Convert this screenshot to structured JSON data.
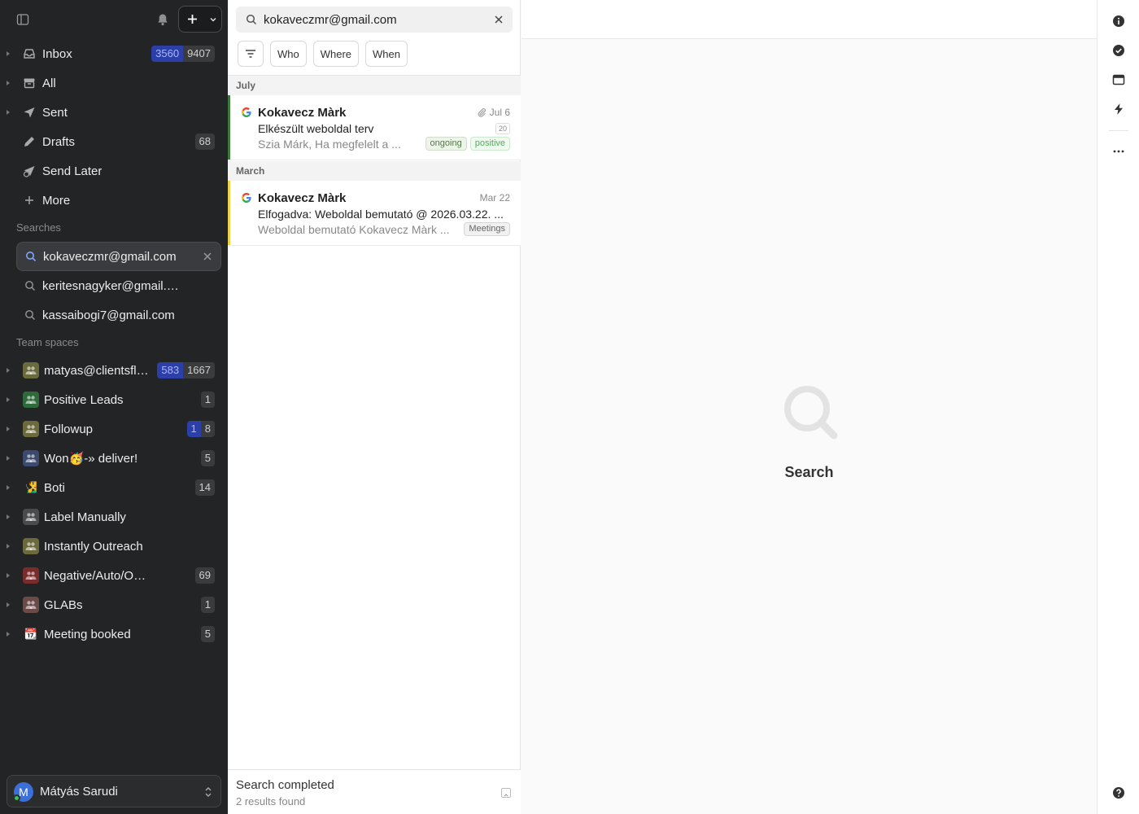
{
  "sidebar": {
    "nav": [
      {
        "label": "Inbox",
        "icon": "inbox-icon",
        "caret": true,
        "badge_blue": "3560",
        "badge_gray": "9407"
      },
      {
        "label": "All",
        "icon": "archive-icon",
        "caret": true
      },
      {
        "label": "Sent",
        "icon": "send-icon",
        "caret": true
      },
      {
        "label": "Drafts",
        "icon": "pencil-icon",
        "caret": false,
        "badge_gray": "68"
      },
      {
        "label": "Send Later",
        "icon": "send-later-icon",
        "caret": false
      },
      {
        "label": "More",
        "icon": "plus-icon",
        "caret": false
      }
    ],
    "searches_title": "Searches",
    "searches": [
      {
        "label": "kokaveczmr@gmail.com",
        "active": true
      },
      {
        "label": "keritesnagyker@gmail.com",
        "active": false
      },
      {
        "label": "kassaibogi7@gmail.com",
        "active": false
      }
    ],
    "team_title": "Team spaces",
    "teams": [
      {
        "label": "matyas@clientsflow",
        "color": "#6b6a3c",
        "emoji": "",
        "badge_blue": "583",
        "badge_gray": "1667"
      },
      {
        "label": "Positive Leads",
        "color": "#2f6b3a",
        "emoji": "",
        "badge_gray": "1"
      },
      {
        "label": "Followup",
        "color": "#6b6a3c",
        "emoji": "",
        "badge_blue": "1",
        "badge_gray": "8"
      },
      {
        "label": "Won🥳-» deliver!",
        "color": "#3b4a6e",
        "emoji": "",
        "badge_gray": "5"
      },
      {
        "label": "Boti",
        "color": "#3b4a6e",
        "emoji": "🧏‍♂️",
        "badge_gray": "14"
      },
      {
        "label": "Label Manually",
        "color": "#4a4b4d",
        "emoji": "",
        "badge_gray": ""
      },
      {
        "label": "Instantly Outreach",
        "color": "#6b6a3c",
        "emoji": "",
        "badge_gray": ""
      },
      {
        "label": "Negative/Auto/OOO Leads",
        "color": "#7a2c2c",
        "emoji": "",
        "badge_gray": "69"
      },
      {
        "label": "GLABs",
        "color": "#6b4a4a",
        "emoji": "",
        "badge_gray": "1"
      },
      {
        "label": "Meeting booked",
        "color": "#3a3b3d",
        "emoji": "📆",
        "badge_gray": "5"
      }
    ],
    "user": {
      "initial": "M",
      "name": "Mátyás Sarudi"
    }
  },
  "list": {
    "search_value": "kokaveczmr@gmail.com",
    "filters": [
      "Who",
      "Where",
      "When"
    ],
    "groups": [
      {
        "title": "July",
        "mails": [
          {
            "from": "Kokavecz Màrk",
            "date": "Jul 6",
            "attachment": true,
            "subject": "Elkészült weboldal terv",
            "count": "20",
            "preview": "Szia Márk, Ha megfelelt a ...",
            "tags": [
              "ongoing",
              "positive"
            ],
            "stripe": "#3a7a3a"
          }
        ]
      },
      {
        "title": "March",
        "mails": [
          {
            "from": "Kokavecz Màrk",
            "date": "Mar 22",
            "attachment": false,
            "subject": "Elfogadva: Weboldal bemutató @ 2026.03.22. ...",
            "count": "",
            "preview": "Weboldal bemutató Kokavecz Màrk ...",
            "tags": [
              "Meetings"
            ],
            "stripe": "#f0d24a"
          }
        ]
      }
    ],
    "status_title": "Search completed",
    "status_sub": "2 results found"
  },
  "main": {
    "empty_label": "Search"
  },
  "rail": [
    "info-icon",
    "check-circle-icon",
    "window-icon",
    "bolt-icon",
    "more-icon",
    "help-icon"
  ]
}
